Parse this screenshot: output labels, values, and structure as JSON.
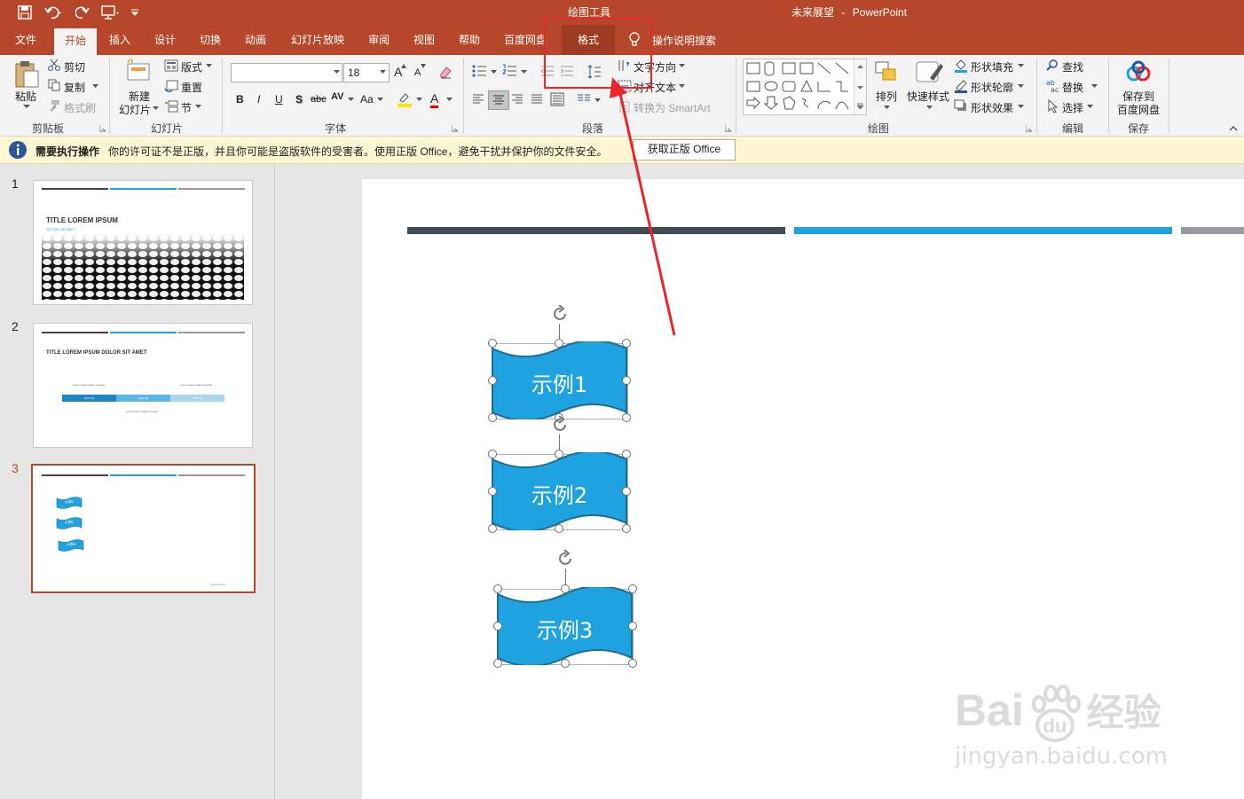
{
  "titlebar": {
    "contextual": "绘图工具",
    "doc_title": "未来展望",
    "dash": "-",
    "app": "PowerPoint"
  },
  "tabs": [
    "文件",
    "开始",
    "插入",
    "设计",
    "切换",
    "动画",
    "幻灯片放映",
    "审阅",
    "视图",
    "帮助",
    "百度网盘",
    "格式"
  ],
  "tell_me": "操作说明搜索",
  "ribbon": {
    "clipboard": {
      "paste": "粘贴",
      "cut": "剪切",
      "copy": "复制",
      "painter": "格式刷",
      "label": "剪贴板"
    },
    "slides": {
      "new1": "新建",
      "new2": "幻灯片",
      "layout": "版式",
      "reset": "重置",
      "section": "节",
      "label": "幻灯片"
    },
    "font": {
      "size": "18",
      "bold": "B",
      "italic": "I",
      "underline": "U",
      "shadow": "S",
      "strike": "abc",
      "spacing": "AV",
      "case": "Aa",
      "color": "A",
      "grow": "A",
      "shrink": "A",
      "label": "字体"
    },
    "paragraph": {
      "dir": "文字方向",
      "align": "对齐文本",
      "smartart": "转换为 SmartArt",
      "label": "段落"
    },
    "drawing": {
      "arrange": "排列",
      "quick": "快速样式",
      "fill": "形状填充",
      "outline": "形状轮廓",
      "effect": "形状效果",
      "label": "绘图"
    },
    "editing": {
      "find": "查找",
      "replace": "替换",
      "select": "选择",
      "label": "编辑"
    },
    "save": {
      "line1": "保存到",
      "line2": "百度网盘",
      "label": "保存"
    }
  },
  "infobar": {
    "title": "需要执行操作",
    "message": "你的许可证不是正版，并且你可能是盗版软件的受害者。使用正版 Office，避免干扰并保护你的文件安全。",
    "button": "获取正版 Office"
  },
  "thumbnails": [
    {
      "num": "1",
      "title": "TITLE LOREM IPSUM",
      "subtitle": "SIT DOLOR AMET"
    },
    {
      "num": "2",
      "title": "TITLE LOREM IPSUM DOLOR SIT AMET",
      "t1": "Lorem ipsum dolor sit amet",
      "t2": "Lorem ipsum dolor sit amet",
      "t3": "Lorem ipsum dolor sit amet",
      "b1": "2017 Q1",
      "b2": "2018 Q2",
      "b3": "2019 Q3"
    },
    {
      "num": "3",
      "b1": "示例1",
      "b2": "示例2",
      "b3": "示例3",
      "footer": "Lorem ipsum"
    }
  ],
  "slide": {
    "shape1": "示例1",
    "shape2": "示例2",
    "shape3": "示例3"
  },
  "watermark": {
    "brand": "Bai",
    "du": "du",
    "cn": "经验",
    "url": "jingyan.baidu.com"
  },
  "colors": {
    "accent": "#b7472a",
    "shape": "#1fa3e0",
    "highlight": "#e8272a"
  }
}
